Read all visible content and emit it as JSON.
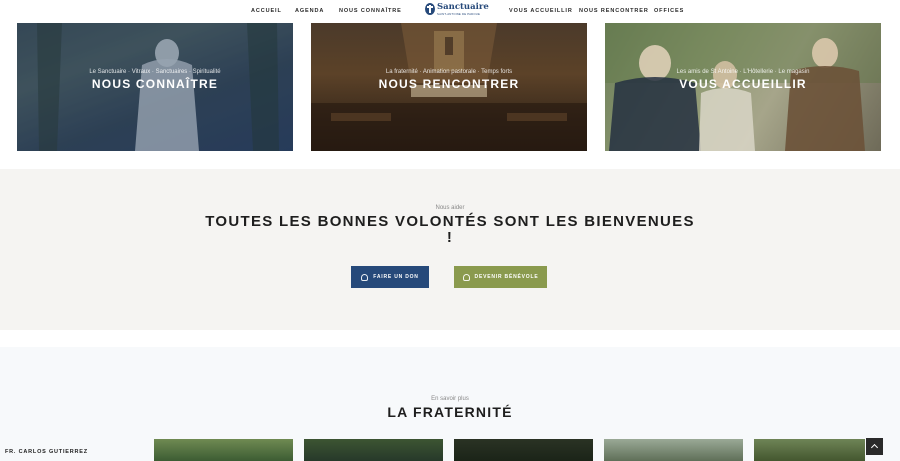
{
  "nav": {
    "left": [
      "ACCUEIL",
      "AGENDA",
      "NOUS CONNAÎTRE"
    ],
    "right": [
      "VOUS ACCUEILLIR",
      "NOUS RENCONTRER",
      "OFFICES"
    ],
    "logo_name": "Sanctuaire",
    "logo_tag": "SAINT-ANTOINE DE PADOUE"
  },
  "cards": [
    {
      "subtitle": "Le Sanctuaire · Vitraux · Sanctuaires · Spiritualité",
      "title": "NOUS CONNAÎTRE"
    },
    {
      "subtitle": "La fraternité · Animation pastorale · Temps forts",
      "title": "NOUS RENCONTRER"
    },
    {
      "subtitle": "Les amis de St Antoine · L'Hôtellerie · Le magasin",
      "title": "VOUS ACCUEILLIR"
    }
  ],
  "cta": {
    "kicker": "Nous aider",
    "heading": "TOUTES LES BONNES VOLONTÉS SONT LES BIENVENUES !",
    "donate_label": "FAIRE UN DON",
    "volunteer_label": "DEVENIR BÉNÉVOLE"
  },
  "fraternite": {
    "kicker": "En savoir plus",
    "heading": "LA FRATERNITÉ",
    "first_name": "FR. CARLOS GUTIERREZ"
  },
  "colors": {
    "primary": "#26497a",
    "accent": "#8a9a4e"
  }
}
